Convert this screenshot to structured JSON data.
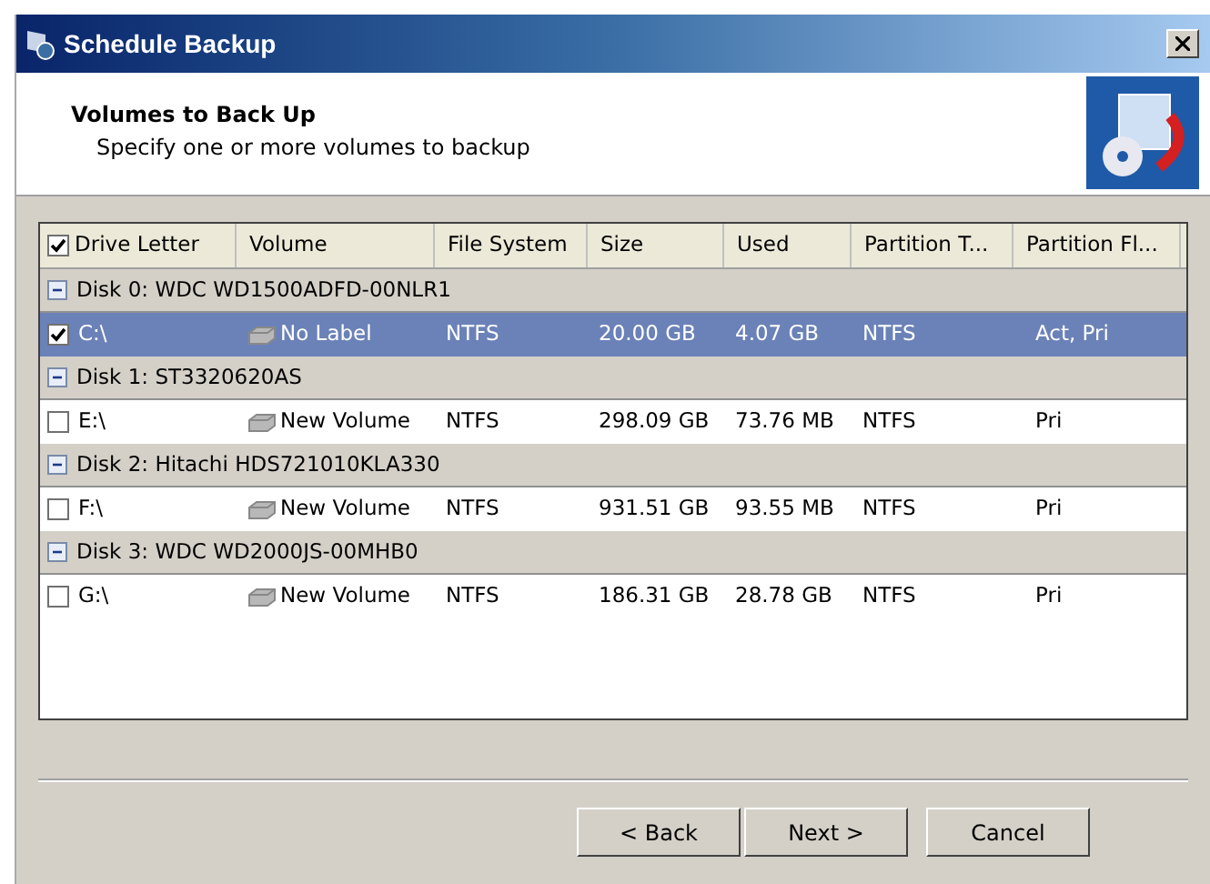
{
  "window": {
    "title": "Schedule Backup"
  },
  "header": {
    "title": "Volumes to Back Up",
    "subtitle": "Specify one or more volumes to backup"
  },
  "table": {
    "select_all_checked": true,
    "columns": [
      "Drive Letter",
      "Volume",
      "File System",
      "Size",
      "Used",
      "Partition T...",
      "Partition Fl..."
    ],
    "groups": [
      {
        "label": "Disk 0: WDC WD1500ADFD-00NLR1",
        "expanded": true,
        "rows": [
          {
            "checked": true,
            "selected": true,
            "cells": [
              "C:\\",
              "No Label",
              "NTFS",
              "20.00 GB",
              "4.07 GB",
              "NTFS",
              "Act, Pri"
            ]
          }
        ]
      },
      {
        "label": "Disk 1: ST3320620AS",
        "expanded": true,
        "rows": [
          {
            "checked": false,
            "selected": false,
            "cells": [
              "E:\\",
              "New Volume",
              "NTFS",
              "298.09 GB",
              "73.76 MB",
              "NTFS",
              "Pri"
            ]
          }
        ]
      },
      {
        "label": "Disk 2: Hitachi HDS721010KLA330",
        "expanded": true,
        "rows": [
          {
            "checked": false,
            "selected": false,
            "cells": [
              "F:\\",
              "New Volume",
              "NTFS",
              "931.51 GB",
              "93.55 MB",
              "NTFS",
              "Pri"
            ]
          }
        ]
      },
      {
        "label": "Disk 3: WDC WD2000JS-00MHB0",
        "expanded": true,
        "rows": [
          {
            "checked": false,
            "selected": false,
            "cells": [
              "G:\\",
              "New Volume",
              "NTFS",
              "186.31 GB",
              "28.78 GB",
              "NTFS",
              "Pri"
            ]
          }
        ]
      }
    ]
  },
  "buttons": [
    "< Back",
    "Next >",
    "Cancel"
  ]
}
